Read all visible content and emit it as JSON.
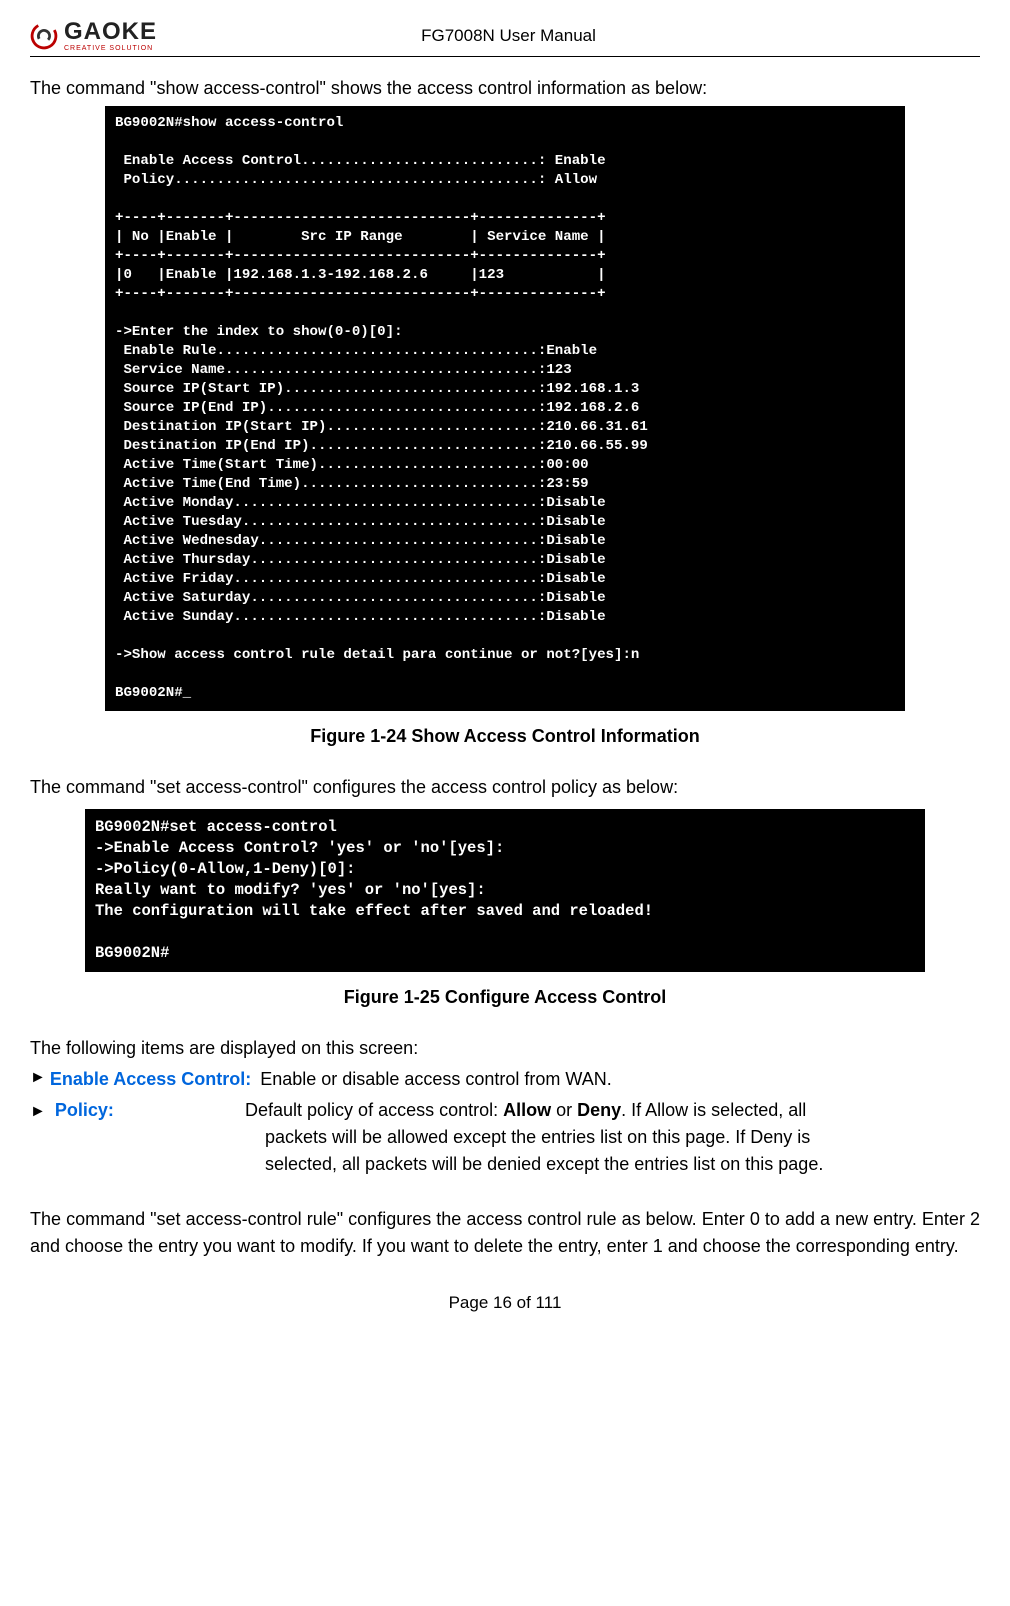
{
  "header": {
    "logo_main": "GAOKE",
    "logo_tag": "CREATIVE SOLUTION",
    "title": "FG7008N User Manual"
  },
  "p1": "The command \"show access-control\" shows the access control information as below:",
  "terminal1": {
    "chart_data": {
      "type": "table",
      "title": "show access-control output",
      "columns": [
        "No",
        "Enable",
        "Src IP Range",
        "Service Name"
      ],
      "rows": [
        [
          "0",
          "Enable",
          "192.168.1.3-192.168.2.6",
          "123"
        ]
      ],
      "settings": {
        "Enable Access Control": "Enable",
        "Policy": "Allow"
      },
      "detail": {
        "Enable Rule": "Enable",
        "Service Name": "123",
        "Source IP(Start IP)": "192.168.1.3",
        "Source IP(End IP)": "192.168.2.6",
        "Destination IP(Start IP)": "210.66.31.61",
        "Destination IP(End IP)": "210.66.55.99",
        "Active Time(Start Time)": "00:00",
        "Active Time(End Time)": "23:59",
        "Active Monday": "Disable",
        "Active Tuesday": "Disable",
        "Active Wednesday": "Disable",
        "Active Thursday": "Disable",
        "Active Friday": "Disable",
        "Active Saturday": "Disable",
        "Active Sunday": "Disable"
      }
    },
    "lines": [
      "BG9002N#show access-control",
      "",
      " Enable Access Control............................: Enable",
      " Policy...........................................: Allow",
      "",
      "+----+-------+----------------------------+--------------+",
      "| No |Enable |        Src IP Range        | Service Name |",
      "+----+-------+----------------------------+--------------+",
      "|0   |Enable |192.168.1.3-192.168.2.6     |123           |",
      "+----+-------+----------------------------+--------------+",
      "",
      "->Enter the index to show(0-0)[0]:",
      " Enable Rule......................................:Enable",
      " Service Name.....................................:123",
      " Source IP(Start IP)..............................:192.168.1.3",
      " Source IP(End IP)................................:192.168.2.6",
      " Destination IP(Start IP).........................:210.66.31.61",
      " Destination IP(End IP)...........................:210.66.55.99",
      " Active Time(Start Time)..........................:00:00",
      " Active Time(End Time)............................:23:59",
      " Active Monday....................................:Disable",
      " Active Tuesday...................................:Disable",
      " Active Wednesday.................................:Disable",
      " Active Thursday..................................:Disable",
      " Active Friday....................................:Disable",
      " Active Saturday..................................:Disable",
      " Active Sunday....................................:Disable",
      "",
      "->Show access control rule detail para continue or not?[yes]:n",
      "",
      "BG9002N#_"
    ]
  },
  "caption1": "Figure 1-24    Show Access Control Information",
  "p2": "The command \"set access-control\" configures the access control policy as below:",
  "terminal2": {
    "lines": [
      "BG9002N#set access-control",
      "->Enable Access Control? 'yes' or 'no'[yes]:",
      "->Policy(0-Allow,1-Deny)[0]:",
      "Really want to modify? 'yes' or 'no'[yes]:",
      "The configuration will take effect after saved and reloaded!",
      "",
      "BG9002N#"
    ]
  },
  "caption2": "Figure 1-25    Configure Access Control",
  "p3": "The following items are displayed on this screen:",
  "bullet1": {
    "arrow": "►",
    "label": "Enable Access Control:",
    "text": " Enable or disable access control from WAN."
  },
  "bullet2": {
    "arrow": "►",
    "label": "Policy:",
    "pre": "Default  policy  of  access  control:  ",
    "bold1": "Allow",
    "mid": "  or  ",
    "bold2": "Deny",
    "post": ".  If  Allow  is  selected,  all",
    "line2": "packets  will  be  allowed  except  the  entries  list  on  this  page.  If  Deny  is",
    "line3": "selected, all packets will be denied except the entries list on this page."
  },
  "p4": "The command \"set access-control rule\" configures the access control rule as below. Enter 0 to add a new entry. Enter 2 and choose the entry you want to modify. If you want to delete the entry, enter 1 and choose the corresponding entry.",
  "footer": "Page 16 of 111"
}
